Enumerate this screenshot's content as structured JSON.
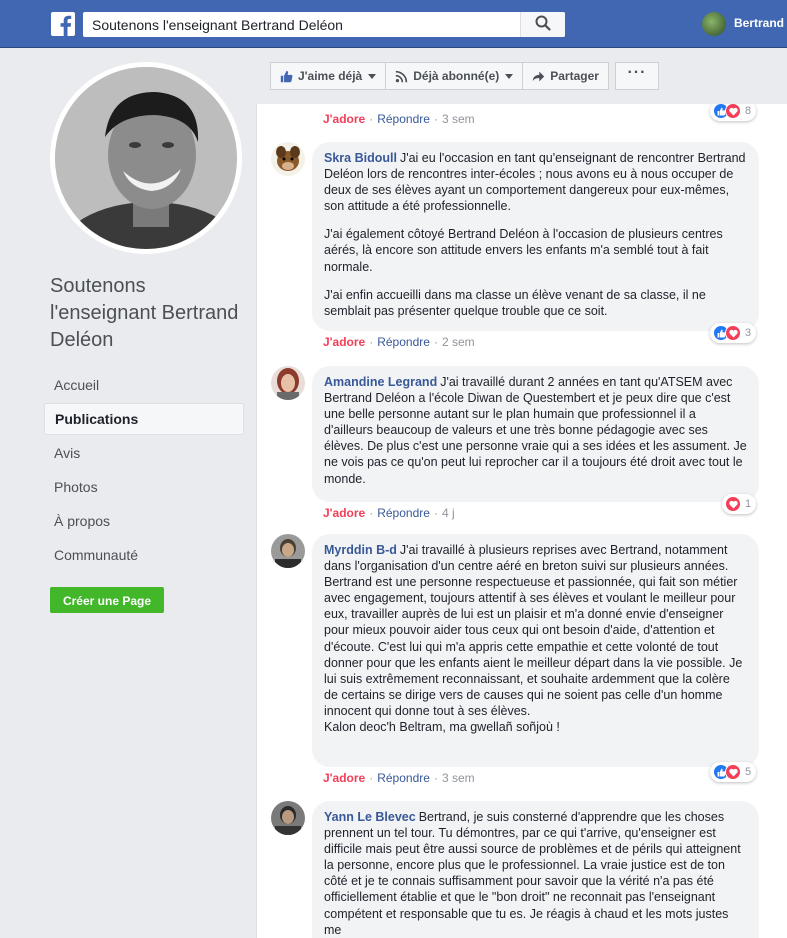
{
  "header": {
    "search_value": "Soutenons l'enseignant Bertrand Deléon",
    "user_name": "Bertrand",
    "brand_color": "#4267b2"
  },
  "sidebar": {
    "page_name": "Soutenons l'enseignant Bertrand Deléon",
    "items": [
      {
        "label": "Accueil"
      },
      {
        "label": "Publications",
        "active": true
      },
      {
        "label": "Avis"
      },
      {
        "label": "Photos"
      },
      {
        "label": "À propos"
      },
      {
        "label": "Communauté"
      }
    ],
    "create_page_label": "Créer une Page"
  },
  "action_bar": {
    "like_label": "J'aime déjà",
    "follow_label": "Déjà abonné(e)",
    "share_label": "Partager",
    "more_label": "···"
  },
  "comments": [
    {
      "author": "",
      "text": [],
      "love_label": "J'adore",
      "reply_label": "Répondre",
      "time": "3 sem",
      "reactions": [
        "like",
        "love"
      ],
      "reaction_count": "8"
    },
    {
      "author": "Skra Bidoull",
      "text": [
        "J'ai eu l'occasion en tant qu'enseignant de rencontrer Bertrand Deléon lors de rencontres inter-écoles ; nous avons eu à nous occuper de deux de ses élèves ayant un comportement dangereux pour eux-mêmes, son attitude a été professionnelle.",
        "J'ai également côtoyé Bertrand Deléon à l'occasion de plusieurs centres aérés, là encore son attitude envers les enfants m'a semblé tout à fait normale.",
        "J'ai enfin accueilli dans ma classe un élève venant de sa classe, il ne semblait pas présenter quelque trouble que ce soit."
      ],
      "love_label": "J'adore",
      "reply_label": "Répondre",
      "time": "2 sem",
      "reactions": [
        "like",
        "love"
      ],
      "reaction_count": "3"
    },
    {
      "author": "Amandine Legrand",
      "text": [
        "J'ai travaillé durant 2 années en tant qu'ATSEM avec Bertrand Deléon a l'école Diwan de Questembert et je peux dire que c'est une belle personne autant sur le plan humain que professionnel il a d'ailleurs beaucoup de valeurs et une très bonne pédagogie avec ses élèves. De plus c'est une personne vraie qui a ses idées et les assument. Je ne vois pas ce qu'on peut lui reprocher car il a toujours été droit avec tout le monde."
      ],
      "love_label": "J'adore",
      "reply_label": "Répondre",
      "time": "4 j",
      "reactions": [
        "love"
      ],
      "reaction_count": "1"
    },
    {
      "author": "Myrddin B-d",
      "text": [
        "J'ai travaillé à plusieurs reprises avec Bertrand, notamment dans l'organisation d'un centre aéré en breton suivi sur plusieurs années. Bertrand est une personne respectueuse et passionnée, qui fait son métier avec engagement, toujours attentif à ses élèves et voulant le meilleur pour eux, travailler auprès de lui est un plaisir et m'a donné envie d'enseigner pour mieux pouvoir aider tous ceux qui ont besoin d'aide, d'attention et d'écoute. C'est lui qui m'a appris cette empathie et cette volonté de tout donner pour que les enfants aient le meilleur départ dans la vie possible. Je lui suis extrêmement reconnaissant, et souhaite ardemment que la colère de certains se dirige vers de causes qui ne soient pas celle d'un homme innocent qui donne tout à ses élèves.",
        "Kalon deoc'h Beltram, ma gwellañ soñjoù !"
      ],
      "love_label": "J'adore",
      "reply_label": "Répondre",
      "time": "3 sem",
      "reactions": [
        "like",
        "love"
      ],
      "reaction_count": "5"
    },
    {
      "author": "Yann Le Blevec",
      "text": [
        "Bertrand, je suis consterné d'apprendre que les choses prennent un tel tour. Tu démontres, par ce qui t'arrive, qu'enseigner est difficile mais peut être aussi source de problèmes et de périls qui atteignent la personne, encore plus que le professionnel. La vraie justice est de ton côté et je te connais suffisamment pour savoir que la vérité n'a pas été officiellement établie et que le \"bon droit\" ne reconnait pas l'enseignant compétent et responsable que tu es. Je réagis à chaud et les mots justes me"
      ]
    }
  ]
}
